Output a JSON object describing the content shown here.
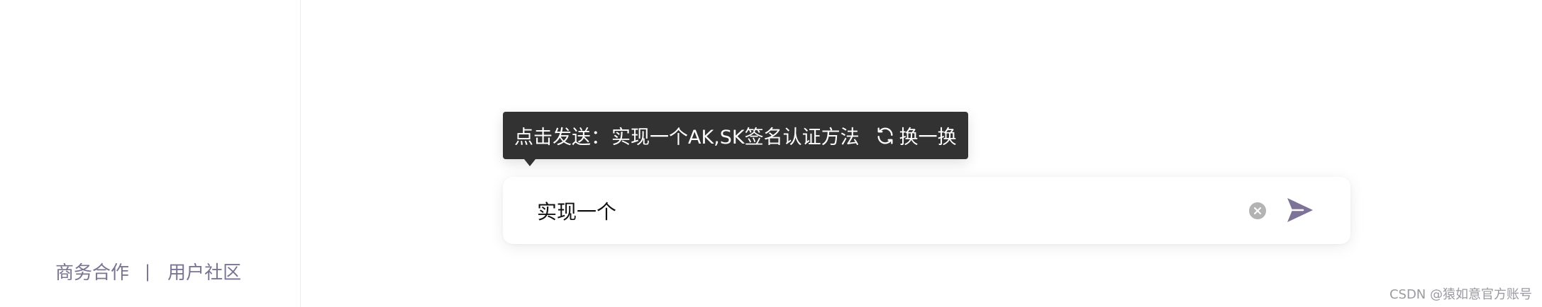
{
  "sidebar": {
    "footer": {
      "business_link": "商务合作",
      "separator": "|",
      "community_link": "用户社区"
    }
  },
  "tooltip": {
    "prefix": "点击发送：",
    "suggestion": "实现一个AK,SK签名认证方法",
    "swap_label": "换一换",
    "swap_icon": "refresh-icon"
  },
  "input": {
    "value": "实现一个",
    "clear_icon": "clear-circle-icon",
    "send_icon": "send-arrow-icon"
  },
  "watermark": "CSDN @猿如意官方账号",
  "colors": {
    "tooltip_bg": "#323232",
    "link": "#7a7494",
    "send_icon": "#7d7399",
    "clear_icon": "#b3b3b3"
  }
}
